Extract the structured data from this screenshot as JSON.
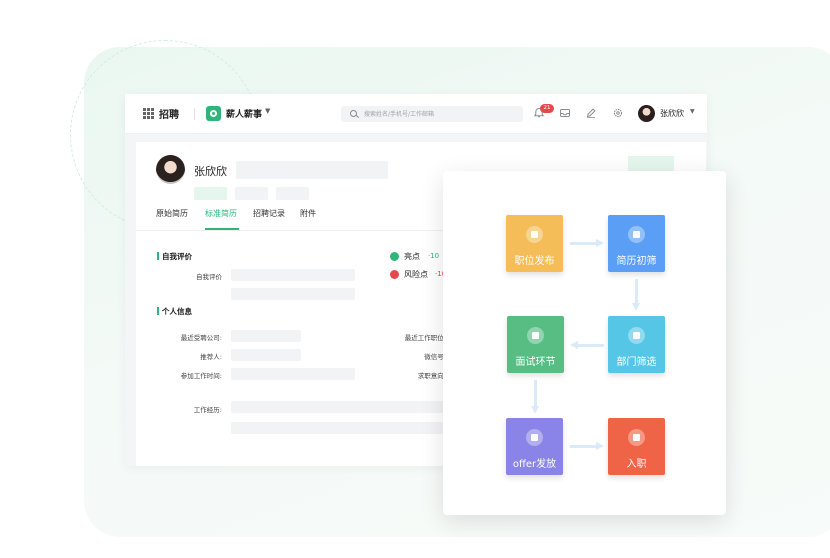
{
  "topbar": {
    "app_name": "招聘",
    "brand_name": "薪人薪事",
    "search_placeholder": "搜索姓名/手机号/工作邮箱",
    "notification_count": "21",
    "user_name": "张欣欣"
  },
  "candidate": {
    "name": "张欣欣"
  },
  "tabs": [
    "原始简历",
    "标准简历",
    "招聘记录",
    "附件"
  ],
  "active_tab": "标准简历",
  "self_eval": {
    "title": "自我评价",
    "field_label": "自我评价",
    "highlight_label": "亮点",
    "highlight_value": "·10",
    "risk_label": "风险点",
    "risk_value": "·10"
  },
  "personal_info": {
    "title": "个人信息",
    "fields_left": [
      "最近受聘公司:",
      "推荐人:",
      "参加工作时间:"
    ],
    "fields_right": [
      "最近工作职位:",
      "微信号:",
      "求职意向:"
    ],
    "work_experience": "工作经历:"
  },
  "flow": {
    "steps": [
      {
        "label": "职位发布",
        "color": "#f5bd57",
        "icon": "document-icon"
      },
      {
        "label": "简历初筛",
        "color": "#5b9ef5",
        "icon": "eraser-icon"
      },
      {
        "label": "部门筛选",
        "color": "#56c6e6",
        "icon": "mail-icon"
      },
      {
        "label": "面试环节",
        "color": "#57bd83",
        "icon": "calendar-icon"
      },
      {
        "label": "offer发放",
        "color": "#8a83e8",
        "icon": "envelope-icon"
      },
      {
        "label": "入职",
        "color": "#ef6346",
        "icon": "briefcase-icon"
      }
    ]
  },
  "colors": {
    "accent": "#2fb57a",
    "badge": "#e5484d"
  }
}
